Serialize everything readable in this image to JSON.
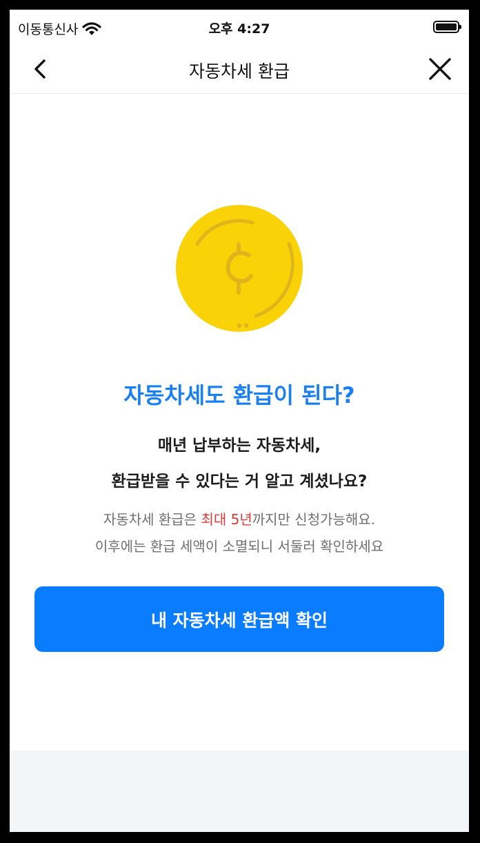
{
  "status_bar": {
    "carrier": "이동통신사",
    "time": "오후 4:27"
  },
  "nav": {
    "title": "자동차세 환급",
    "back_icon": "chevron-left-icon",
    "close_icon": "close-icon"
  },
  "hero": {
    "icon": "coin-icon",
    "headline": "자동차세도 환급이 된다?",
    "subtitle_line1": "매년 납부하는 자동차세,",
    "subtitle_line2": "환급받을 수 있다는 거 알고 계셨나요?",
    "desc_line1_prefix": "자동차세 환급은 ",
    "desc_line1_highlight": "최대 5년",
    "desc_line1_suffix": "까지만 신청가능해요.",
    "desc_line2": "이후에는 환급 세액이 소멸되니 서둘러 확인하세요"
  },
  "cta": {
    "label": "내 자동차세 환급액 확인"
  },
  "colors": {
    "accent": "#0a7cff",
    "headline": "#1a80f0",
    "highlight": "#d93838",
    "coin": "#f9d308"
  }
}
